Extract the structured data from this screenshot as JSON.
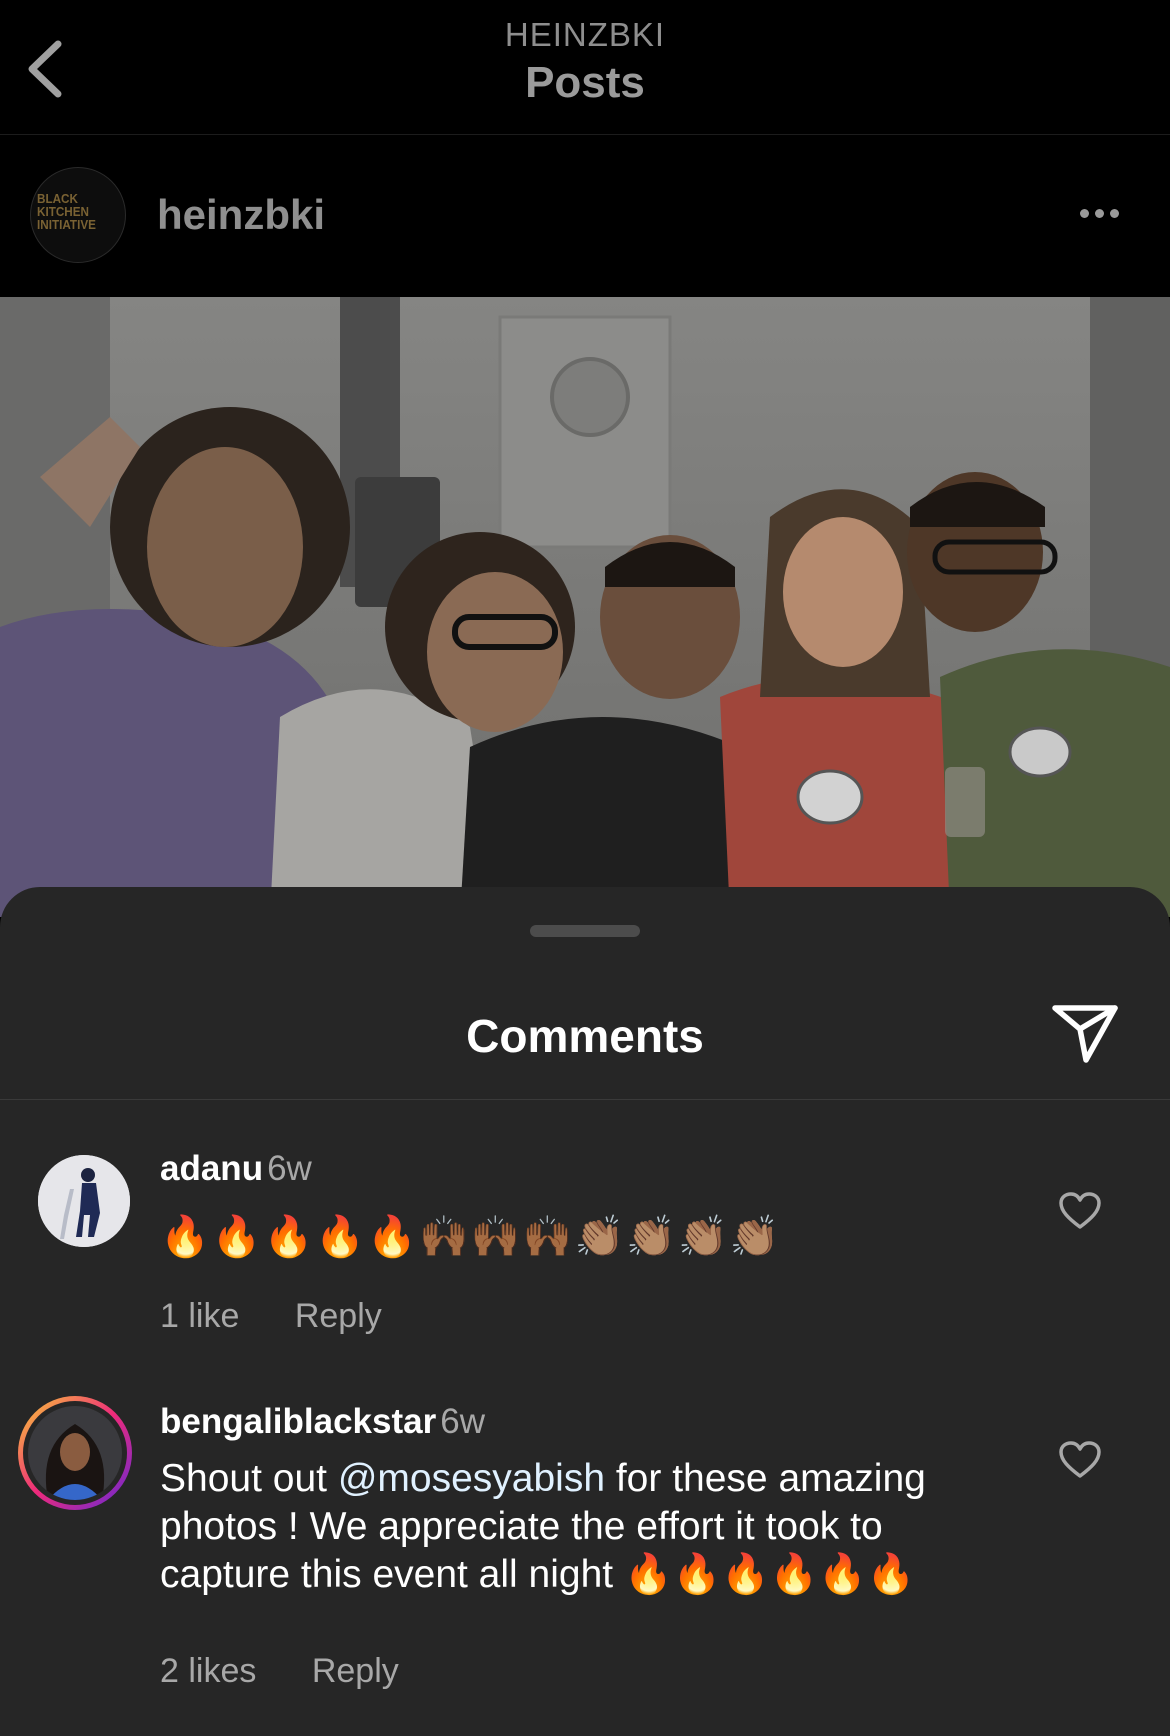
{
  "header": {
    "account_label": "HEINZBKI",
    "title": "Posts",
    "back_icon": "chevron-left-icon"
  },
  "post": {
    "username": "heinzbki",
    "avatar_logo_lines": [
      "BLACK",
      "KITCHEN",
      "INITIATIVE"
    ],
    "more_icon": "more-horizontal-icon"
  },
  "comments_sheet": {
    "title": "Comments",
    "share_icon": "send-icon",
    "comments": [
      {
        "username": "adanu",
        "time": "6w",
        "text": "🔥🔥🔥🔥🔥🙌🏾🙌🏾🙌🏾👏🏽👏🏽👏🏽👏🏽",
        "likes": "1 like",
        "reply": "Reply"
      },
      {
        "username": "bengaliblackstar",
        "time": "6w",
        "text_before": "Shout out ",
        "mention": "@mosesyabish",
        "text_after": " for these amazing photos ! We appreciate the effort it took to capture this event all night 🔥🔥🔥🔥🔥🔥",
        "likes": "2 likes",
        "reply": "Reply"
      }
    ]
  },
  "colors": {
    "background": "#000000",
    "sheet": "#262626",
    "muted_text": "#a8a8a8",
    "mention": "#e0f1ff",
    "story_ring_start": "#f9ce34",
    "story_ring_end": "#c13584"
  }
}
